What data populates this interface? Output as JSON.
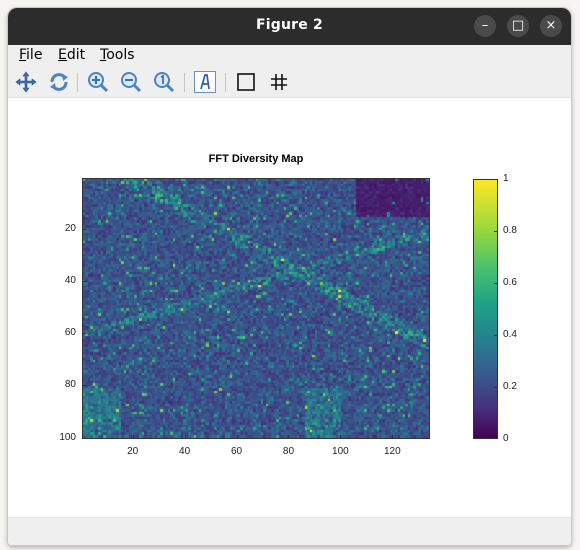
{
  "window": {
    "title": "Figure 2",
    "minimize_glyph": "–",
    "maximize_glyph": "□",
    "close_glyph": "×"
  },
  "menu": [
    {
      "label": "File",
      "mnemonic": "F"
    },
    {
      "label": "Edit",
      "mnemonic": "E"
    },
    {
      "label": "Tools",
      "mnemonic": "T"
    }
  ],
  "toolbar": [
    {
      "icon": "pan-icon"
    },
    {
      "icon": "rotate-icon"
    },
    {
      "icon": "zoom-in-icon"
    },
    {
      "icon": "zoom-out-icon"
    },
    {
      "icon": "reset-zoom-icon"
    },
    {
      "icon": "insert-text-icon"
    },
    {
      "icon": "axes-box-icon"
    },
    {
      "icon": "grid-icon"
    }
  ],
  "chart_data": {
    "type": "heatmap",
    "title": "FFT Diversity Map",
    "colormap": "viridis",
    "x_ticks": [
      "20",
      "40",
      "60",
      "80",
      "100",
      "120"
    ],
    "y_ticks": [
      "20",
      "40",
      "60",
      "80",
      "100"
    ],
    "xlim": [
      0.5,
      134.5
    ],
    "ylim": [
      0.5,
      100.5
    ],
    "clim": [
      0,
      1
    ],
    "colorbar_ticks": [
      "0",
      "0.2",
      "0.4",
      "0.6",
      "0.8",
      "1"
    ]
  }
}
